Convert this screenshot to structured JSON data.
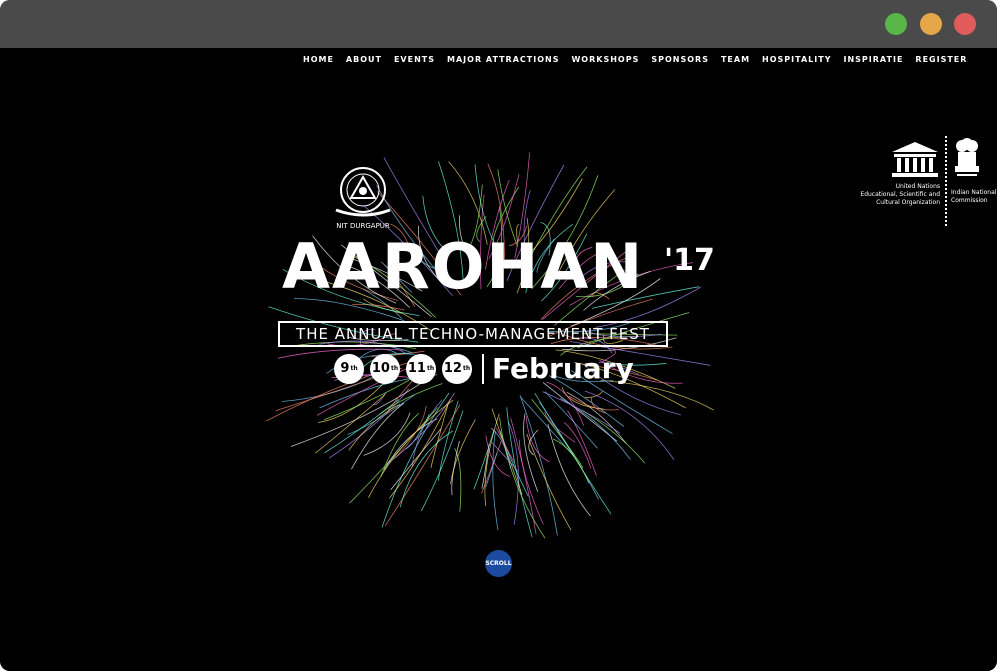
{
  "window": {
    "controls": [
      "green",
      "yellow",
      "red"
    ],
    "colors": {
      "green": "#57b645",
      "yellow": "#e5a64a",
      "red": "#e05c5c",
      "titlebar": "#4a4a4a"
    }
  },
  "nav": {
    "items": [
      "HOME",
      "ABOUT",
      "EVENTS",
      "MAJOR ATTRACTIONS",
      "WORKSHOPS",
      "SPONSORS",
      "TEAM",
      "HOSPITALITY",
      "INSPIRATIE",
      "REGISTER"
    ]
  },
  "hero": {
    "college": "NIT DURGAPUR",
    "title": "AAROHAN",
    "year": "'17",
    "subtitle": "THE ANNUAL TECHNO-MANAGEMENT FEST",
    "days": [
      {
        "num": "9",
        "suffix": "th"
      },
      {
        "num": "10",
        "suffix": "th"
      },
      {
        "num": "11",
        "suffix": "th"
      },
      {
        "num": "12",
        "suffix": "th"
      }
    ],
    "month": "February",
    "scroll_label": "SCROLL",
    "scroll_color": "#1b4aa0"
  },
  "partners": {
    "unesco_line1": "United Nations",
    "unesco_line2": "Educational, Scientific and",
    "unesco_line3": "Cultural Organization",
    "commission_line1": "Indian National",
    "commission_line2": "Commission"
  }
}
